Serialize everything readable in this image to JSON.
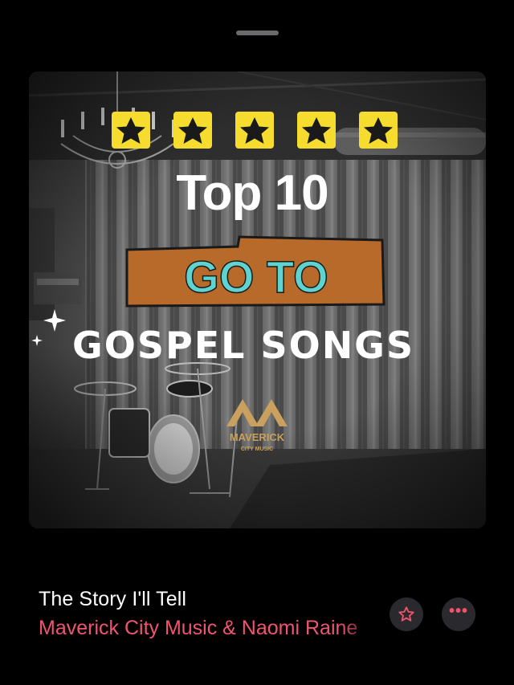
{
  "player": {
    "track_title": "The Story I'll Tell",
    "artist": "Maverick City Music & Naomi Raine",
    "accent_color": "#f0546f",
    "favorite_icon": "star-outline-icon",
    "more_icon": "ellipsis-icon"
  },
  "artwork": {
    "rating_stars": 5,
    "headline": "Top 10",
    "banner_text": "GO TO",
    "subtitle": "GOSPEL SONGS",
    "logo_name": "MAVERICK",
    "logo_tagline": "CITY MUSIC",
    "star_color": "#f6dc2e",
    "banner_color": "#b86a2a",
    "banner_text_color": "#5fd3cf"
  }
}
